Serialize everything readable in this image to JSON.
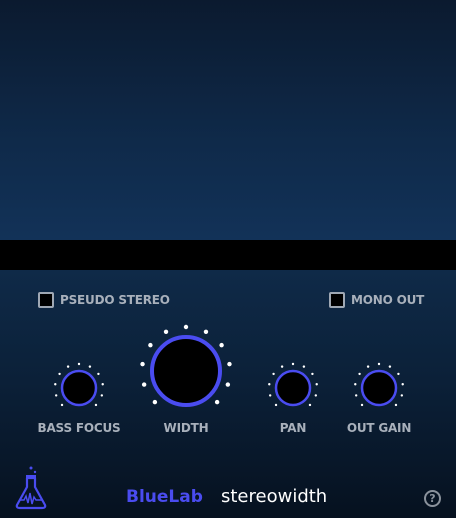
{
  "options": {
    "pseudo_stereo": {
      "label": "PSEUDO STEREO",
      "checked": false
    },
    "mono_out": {
      "label": "MONO OUT",
      "checked": false
    }
  },
  "knobs": {
    "bass_focus": {
      "label": "BASS FOCUS"
    },
    "width": {
      "label": "WIDTH"
    },
    "pan": {
      "label": "PAN"
    },
    "out_gain": {
      "label": "OUT GAIN"
    }
  },
  "footer": {
    "brand": "BlueLab",
    "plugin_name": "stereowidth",
    "help_glyph": "?",
    "logo_icon": "flask-waveform-icon"
  },
  "colors": {
    "accent": "#4a4cf0",
    "label": "#a8b0bb",
    "background_top": "#0b1a2f",
    "background_bottom": "#06111f"
  }
}
